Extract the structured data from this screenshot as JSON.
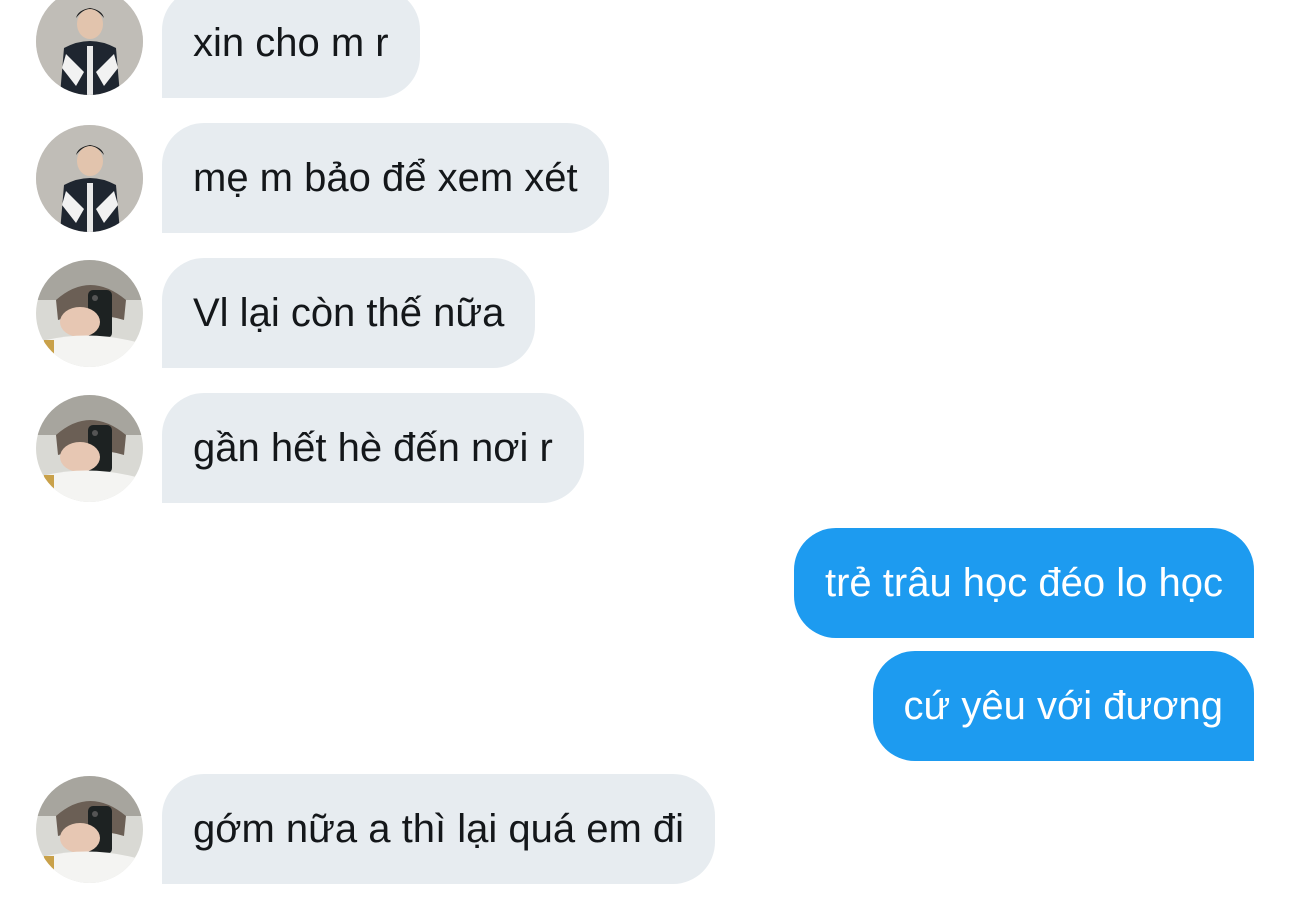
{
  "conversation": {
    "messages": [
      {
        "text": "xin cho m r",
        "direction": "incoming",
        "avatar": "avatar-jacket-photo"
      },
      {
        "text": "mẹ m bảo để xem xét",
        "direction": "incoming",
        "avatar": "avatar-jacket-photo"
      },
      {
        "text": "Vl lại còn thế nữa",
        "direction": "incoming",
        "avatar": "avatar-mirror-selfie"
      },
      {
        "text": "gần hết hè đến nơi r",
        "direction": "incoming",
        "avatar": "avatar-mirror-selfie"
      },
      {
        "text": "trẻ trâu học đéo lo học",
        "direction": "outgoing"
      },
      {
        "text": "cứ yêu với đương",
        "direction": "outgoing"
      },
      {
        "text": "gớm nữa a thì lại quá em đi",
        "direction": "incoming",
        "avatar": "avatar-mirror-selfie"
      }
    ]
  },
  "colors": {
    "incoming_bubble": "#e7ecf0",
    "incoming_text": "#14171a",
    "outgoing_bubble": "#1d9bf0",
    "outgoing_text": "#ffffff",
    "background": "#ffffff"
  }
}
